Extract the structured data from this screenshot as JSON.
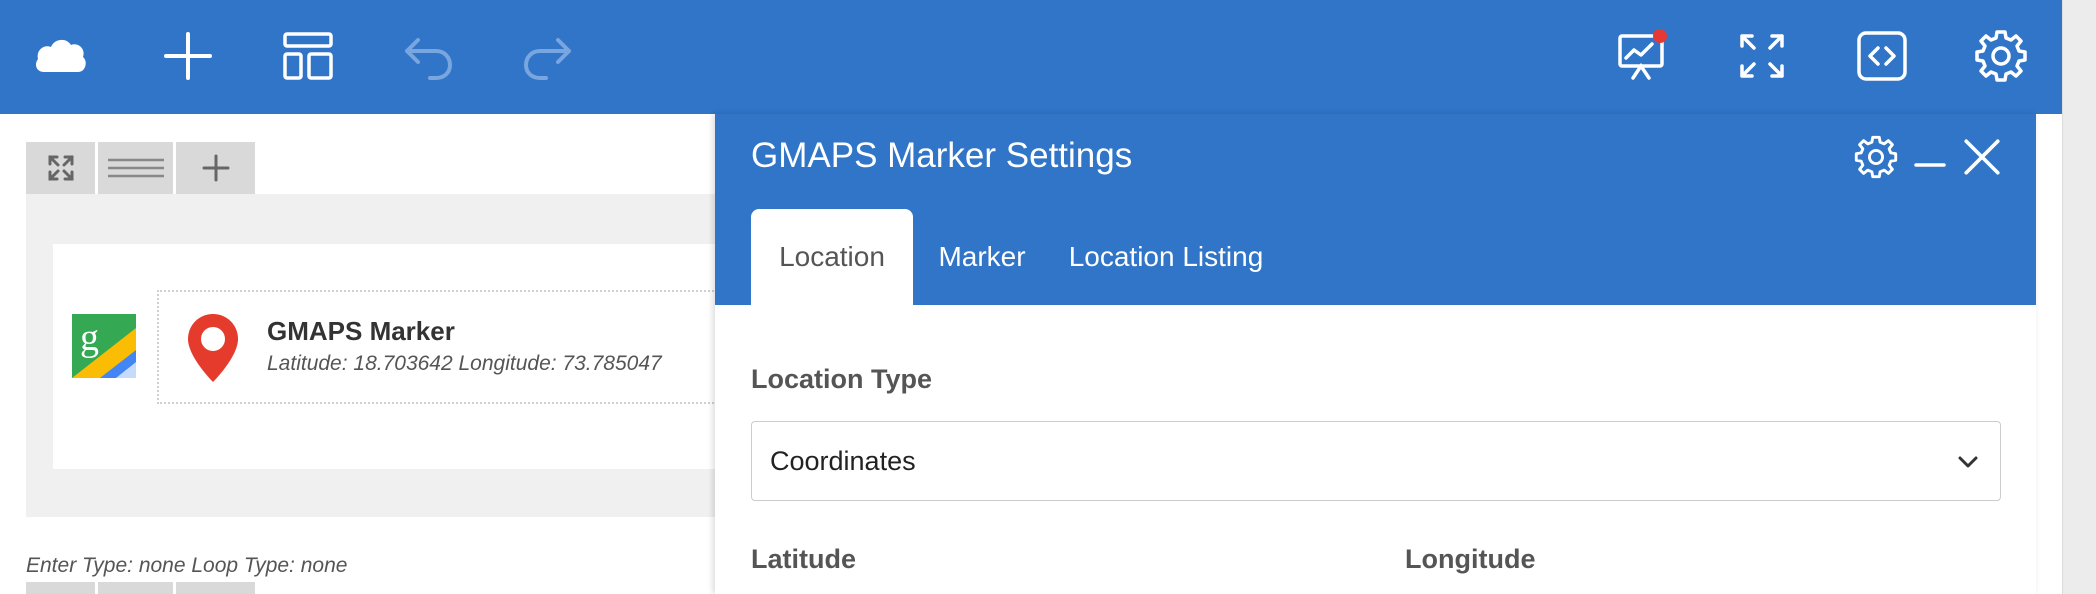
{
  "toolbar": {
    "icons": [
      "cloud-icon",
      "plus-icon",
      "layout-icon",
      "undo-icon",
      "redo-icon",
      "presentation-chart-icon",
      "fullscreen-icon",
      "code-icon",
      "gear-icon"
    ],
    "notification_dot_color": "#e53935",
    "background_color": "#3075c8"
  },
  "builder": {
    "section_toolbar": [
      "expand-icon",
      "drag-handle-icon",
      "plus-icon"
    ],
    "module": {
      "title": "GMAPS Marker",
      "subtitle": "Latitude: 18.703642  Longitude: 73.785047"
    },
    "footer_text": "Enter Type: none  Loop Type: none"
  },
  "panel": {
    "title": "GMAPS Marker Settings",
    "header_icons": [
      "gear-icon",
      "minimize-icon",
      "close-icon"
    ],
    "tabs": [
      {
        "label": "Location",
        "active": true
      },
      {
        "label": "Marker",
        "active": false
      },
      {
        "label": "Location Listing",
        "active": false
      }
    ],
    "location_type": {
      "label": "Location Type",
      "value": "Coordinates"
    },
    "latitude_label": "Latitude",
    "longitude_label": "Longitude"
  }
}
